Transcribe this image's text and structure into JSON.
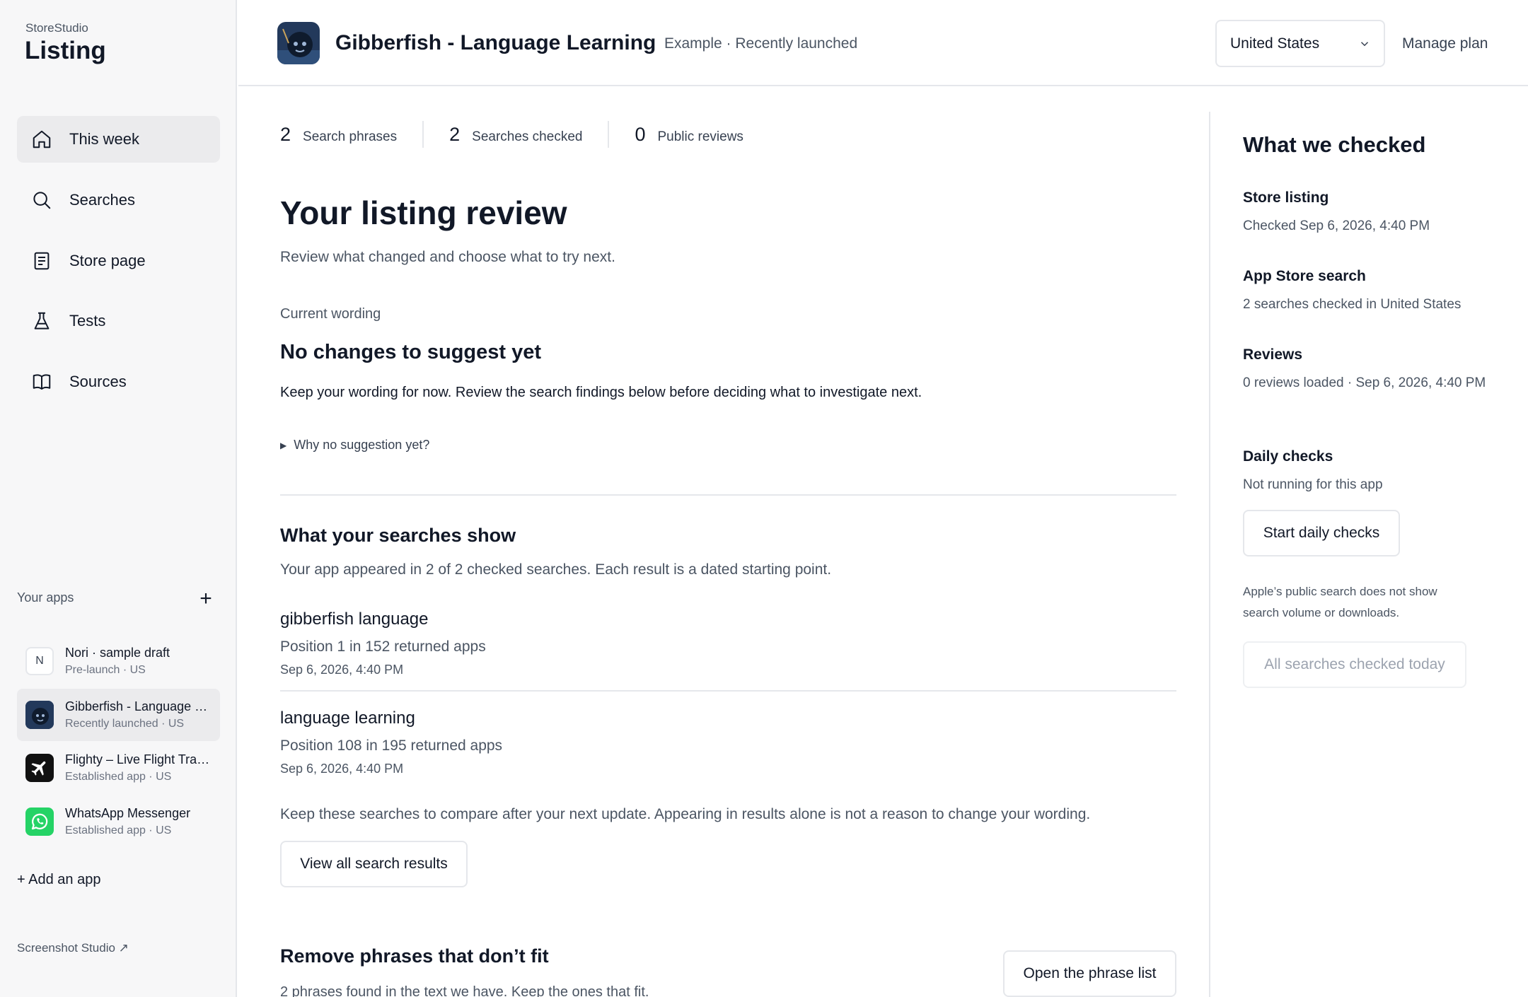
{
  "sidebar": {
    "brand_small": "StoreStudio",
    "brand_big": "Listing",
    "nav": [
      {
        "label": "This week",
        "icon": "home-icon",
        "active": true
      },
      {
        "label": "Searches",
        "icon": "search-icon",
        "active": false
      },
      {
        "label": "Store page",
        "icon": "document-icon",
        "active": false
      },
      {
        "label": "Tests",
        "icon": "flask-icon",
        "active": false
      },
      {
        "label": "Sources",
        "icon": "book-icon",
        "active": false
      }
    ],
    "your_apps_label": "Your apps",
    "add_symbol": "+",
    "apps": [
      {
        "name": "Nori · sample draft",
        "sub": "Pre-launch · US",
        "initial": "N"
      },
      {
        "name": "Gibberfish - Language Learning",
        "sub": "Recently launched · US"
      },
      {
        "name": "Flighty – Live Flight Tracker",
        "sub": "Established app · US"
      },
      {
        "name": "WhatsApp Messenger",
        "sub": "Established app · US"
      }
    ],
    "add_app": "+ Add an app",
    "screenshot_link": "Screenshot Studio ↗"
  },
  "header": {
    "title": "Gibberfish - Language Learning",
    "subtitle": "Example · Recently launched",
    "country": "United States",
    "manage_plan": "Manage plan"
  },
  "stats": [
    {
      "value": "2",
      "label": "Search phrases"
    },
    {
      "value": "2",
      "label": "Searches checked"
    },
    {
      "value": "0",
      "label": "Public reviews"
    }
  ],
  "main": {
    "title": "Your listing review",
    "subtitle": "Review what changed and choose what to try next.",
    "current_wording_label": "Current wording",
    "current_wording_title": "No changes to suggest yet",
    "current_wording_body": "Keep your wording for now. Review the search findings below before deciding what to investigate next.",
    "why_label": "Why no suggestion yet?",
    "searches_title": "What your searches show",
    "searches_sub": "Your app appeared in 2 of 2 checked searches. Each result is a dated starting point.",
    "results": [
      {
        "phrase": "gibberfish language",
        "position": "Position 1 in 152 returned apps",
        "date": "Sep 6, 2026, 4:40 PM"
      },
      {
        "phrase": "language learning",
        "position": "Position 108 in 195 returned apps",
        "date": "Sep 6, 2026, 4:40 PM"
      }
    ],
    "keep_note": "Keep these searches to compare after your next update. Appearing in results alone is not a reason to change your wording.",
    "view_all_button": "View all search results",
    "remove_title": "Remove phrases that don’t fit",
    "remove_sub": "2 phrases found in the text we have. Keep the ones that fit.",
    "open_phrase_button": "Open the phrase list"
  },
  "right_panel": {
    "title": "What we checked",
    "items": [
      {
        "heading": "Store listing",
        "text": "Checked Sep 6, 2026, 4:40 PM"
      },
      {
        "heading": "App Store search",
        "text": "2 searches checked in United States"
      },
      {
        "heading": "Reviews",
        "text": "0 reviews loaded · Sep 6, 2026, 4:40 PM"
      },
      {
        "heading": "Daily checks",
        "text": "Not running for this app"
      }
    ],
    "start_button": "Start daily checks",
    "note": "Apple’s public search does not show search volume or downloads.",
    "disabled_button": "All searches checked today"
  }
}
